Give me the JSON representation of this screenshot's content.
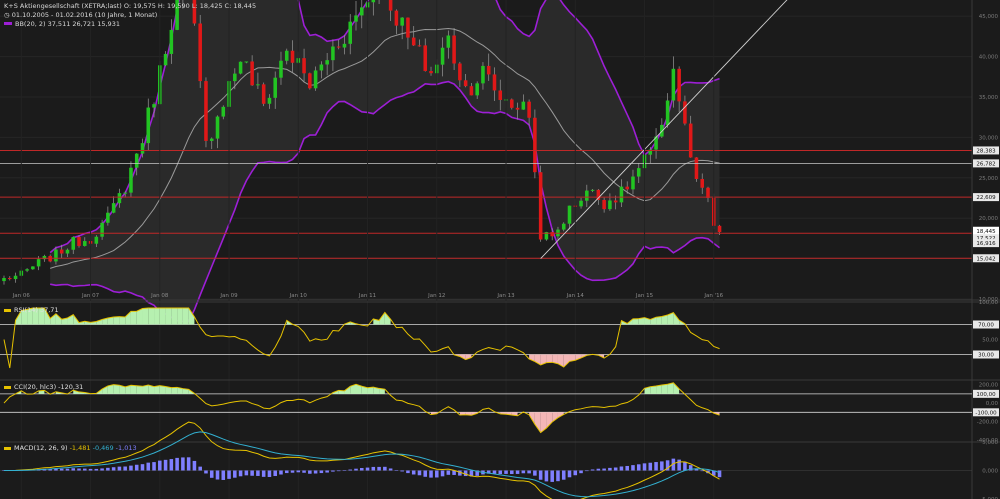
{
  "header": {
    "line1": "K+S Aktiengesellschaft (XETRA;last) O: 19,575 H: 19,590 L: 18,425 C: 18,445",
    "line2": "01.10.2005 - 01.02.2016 (10 Jahre, 1 Monat)",
    "line3": "BB(20, 2) 37,511 26,721 15,931"
  },
  "panels": {
    "rsi_label": "RSI(14) 37,71",
    "cci_label": "CCI(20, hlc3) -120,31",
    "macd_label_prefix": "MACD(12, 26, 9)",
    "macd_v1": "-1,481",
    "macd_v2": "-0,469",
    "macd_v3": "-1,013"
  },
  "colors": {
    "background": "#1b1b1b",
    "up_candle": "#22c422",
    "down_candle": "#e01818",
    "bollinger_bands": "#9d1fd6",
    "bollinger_mid": "#9a9a9a",
    "trendline": "#d0d0d0",
    "hline_red": "#c02828",
    "hline_white": "#c8c8c8",
    "indicator_line": "#e6c200",
    "indicator_fill_pos": "#b6f0b0",
    "indicator_fill_neg": "#f3b6b6",
    "macd_signal": "#33b0d0",
    "macd_hist": "#7f7fff"
  },
  "chart_data": [
    {
      "type": "candlestick",
      "title": "K+S Aktiengesellschaft (XETRA;last)",
      "x_tick_labels": [
        "Jan 06",
        "Jan 07",
        "Jan 08",
        "Jan 09",
        "Jan 10",
        "Jan 11",
        "Jan 12",
        "Jan 13",
        "Jan 14",
        "Jan 15",
        "Jan '16"
      ],
      "y_tick_labels": [
        "10,000",
        "15,000",
        "20,000",
        "25,000",
        "30,000",
        "35,000",
        "40,000",
        "45,000"
      ],
      "ylim": [
        10,
        47
      ],
      "price_labels": [
        "28,383",
        "26,782",
        "22,609",
        "18,135",
        "18,445",
        "17,522",
        "16,916",
        "15,042"
      ],
      "red_levels": [
        28.383,
        22.609,
        18.135,
        15.042
      ],
      "white_levels": [
        26.782
      ],
      "trendline": {
        "from": {
          "date": "2013-07",
          "price": 15.0
        },
        "to": {
          "date": "2016-01",
          "price": 37.5
        }
      },
      "close_path": [
        [
          "2005-10",
          12.5
        ],
        [
          "2006-01",
          13.0
        ],
        [
          "2006-04",
          14.5
        ],
        [
          "2006-07",
          15.5
        ],
        [
          "2006-10",
          17.0
        ],
        [
          "2007-01",
          17.5
        ],
        [
          "2007-04",
          20.0
        ],
        [
          "2007-07",
          24.0
        ],
        [
          "2007-10",
          30.0
        ],
        [
          "2008-01",
          38.0
        ],
        [
          "2008-03",
          45.0
        ],
        [
          "2008-06",
          50.0
        ],
        [
          "2008-09",
          29.0
        ],
        [
          "2008-11",
          33.0
        ],
        [
          "2009-03",
          40.0
        ],
        [
          "2009-07",
          34.0
        ],
        [
          "2009-11",
          41.0
        ],
        [
          "2010-03",
          36.5
        ],
        [
          "2010-07",
          41.0
        ],
        [
          "2010-11",
          45.0
        ],
        [
          "2011-03",
          50.0
        ],
        [
          "2011-08",
          42.0
        ],
        [
          "2011-12",
          38.0
        ],
        [
          "2012-03",
          42.0
        ],
        [
          "2012-06",
          36.0
        ],
        [
          "2012-09",
          38.0
        ],
        [
          "2012-12",
          35.0
        ],
        [
          "2013-03",
          34.0
        ],
        [
          "2013-05",
          33.0
        ],
        [
          "2013-07",
          18.0
        ],
        [
          "2013-09",
          17.5
        ],
        [
          "2013-12",
          21.0
        ],
        [
          "2014-03",
          23.5
        ],
        [
          "2014-06",
          22.0
        ],
        [
          "2014-09",
          23.0
        ],
        [
          "2014-12",
          26.0
        ],
        [
          "2015-03",
          29.0
        ],
        [
          "2015-06",
          38.5
        ],
        [
          "2015-08",
          31.0
        ],
        [
          "2015-10",
          24.0
        ],
        [
          "2015-12",
          22.5
        ],
        [
          "2016-01",
          18.445
        ]
      ]
    },
    {
      "type": "line",
      "title": "RSI(14) 37,71",
      "y_tick_labels": [
        "100,00",
        "70,00",
        "50,00",
        "30,00"
      ],
      "ylim": [
        0,
        100
      ],
      "levels": [
        70,
        30
      ]
    },
    {
      "type": "line",
      "title": "CCI(20, hlc3) -120,31",
      "y_tick_labels": [
        "200,00",
        "100,00",
        "0,00",
        "-100,00",
        "-200,00",
        "-400,00"
      ],
      "ylim": [
        -400,
        250
      ],
      "levels": [
        100,
        -100
      ]
    },
    {
      "type": "line",
      "title": "MACD(12, 26, 9)",
      "y_tick_labels": [
        "5,000",
        "0,000",
        "-5,000"
      ],
      "ylim": [
        -5,
        5
      ]
    }
  ]
}
